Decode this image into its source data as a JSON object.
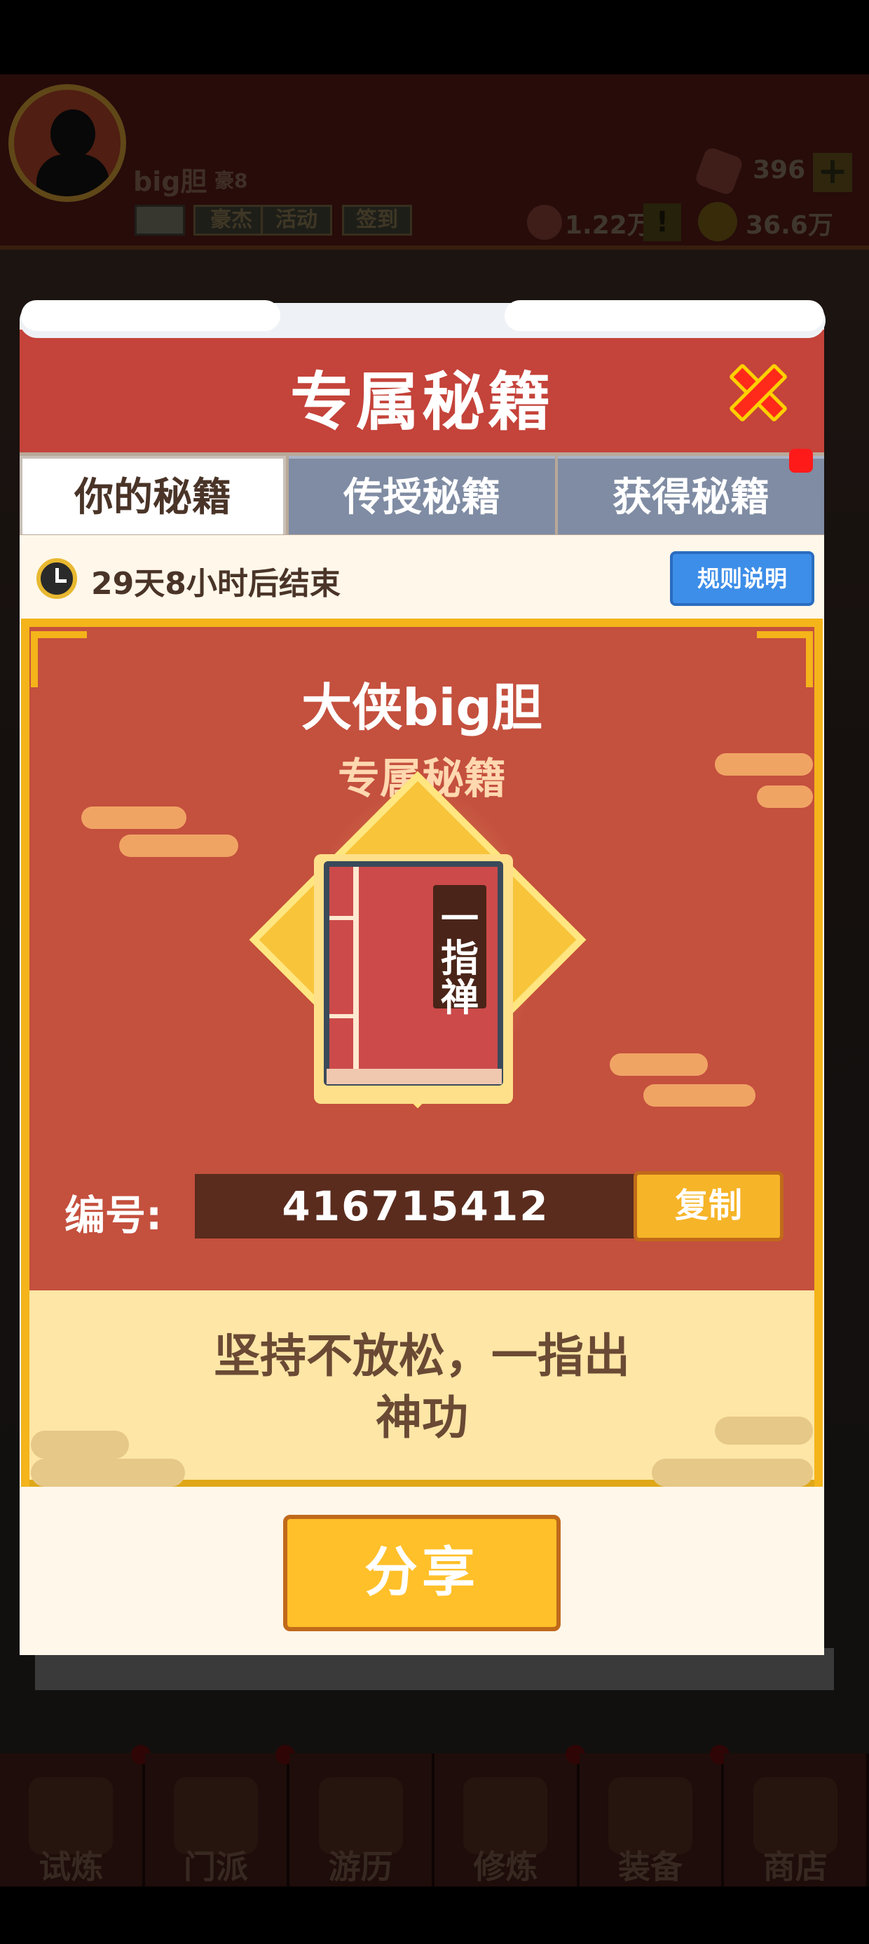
{
  "player": {
    "name": "big胆",
    "rank": "豪8"
  },
  "hud": {
    "gems": "396",
    "plus": "+",
    "tokens": "1.22万",
    "alert": "!",
    "coins": "36.6万",
    "buttons": [
      "豪杰",
      "活动",
      "签到"
    ]
  },
  "modal": {
    "title": "专属秘籍",
    "tabs": [
      "你的秘籍",
      "传授秘籍",
      "获得秘籍"
    ],
    "timer": "29天8小时后结束",
    "rules_button": "规则说明",
    "hero_name": "大侠big胆",
    "hero_sub": "专属秘籍",
    "book_title": [
      "一",
      "指",
      "禅"
    ],
    "code_label": "编号:",
    "code_value": "416715412",
    "copy_button": "复制",
    "slogan": [
      "坚持不放松，一指出",
      "神功"
    ],
    "share_button": "分享"
  },
  "bottom_nav": [
    "试炼",
    "门派",
    "游历",
    "修炼",
    "装备",
    "商店"
  ],
  "colors": {
    "header_red": "#c4433a",
    "panel_red": "#c4503e",
    "gold": "#f4b41a",
    "tab_inactive": "#7f8ca3",
    "rules_blue": "#3d8ee8",
    "close_red": "#ff2a1a"
  }
}
